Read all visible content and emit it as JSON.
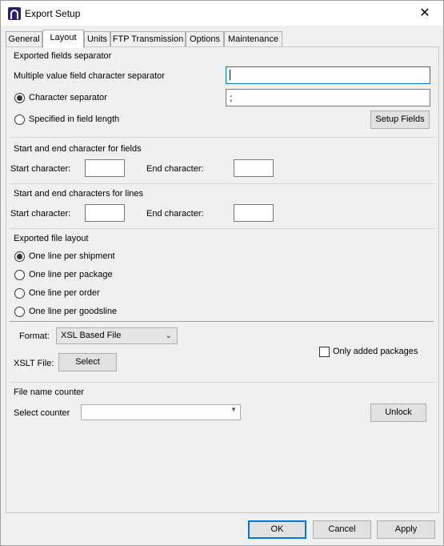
{
  "window": {
    "title": "Export Setup",
    "close_glyph": "✕"
  },
  "tabs": [
    {
      "label": "General"
    },
    {
      "label": "Layout"
    },
    {
      "label": "Units"
    },
    {
      "label": "FTP Transmission"
    },
    {
      "label": "Options"
    },
    {
      "label": "Maintenance"
    }
  ],
  "separator_group": {
    "title": "Exported fields separator",
    "multi_label": "Multiple value field character separator",
    "multi_value": "",
    "char_sep_label": "Character separator",
    "char_sep_value": ";",
    "char_sep_selected": true,
    "field_length_label": "Specified in field length",
    "setup_fields_label": "Setup Fields"
  },
  "fields_group": {
    "title": "Start and end character for fields",
    "start_label": "Start character:",
    "start_value": "",
    "end_label": "End character:",
    "end_value": ""
  },
  "lines_group": {
    "title": "Start and end characters for lines",
    "start_label": "Start character:",
    "start_value": "",
    "end_label": "End character:",
    "end_value": ""
  },
  "layout_group": {
    "title": "Exported file layout",
    "options": [
      {
        "label": "One line per shipment",
        "selected": true
      },
      {
        "label": "One line per package",
        "selected": false
      },
      {
        "label": "One line per order",
        "selected": false
      },
      {
        "label": "One line per goodsline",
        "selected": false
      }
    ],
    "format_label": "Format:",
    "format_value": "XSL Based File",
    "xslt_label": "XSLT File:",
    "select_label": "Select",
    "only_added_label": "Only added packages",
    "only_added_checked": false
  },
  "counter_group": {
    "title": "File name counter",
    "select_label": "Select counter",
    "select_value": "",
    "unlock_label": "Unlock"
  },
  "footer": {
    "ok_label": "OK",
    "cancel_label": "Cancel",
    "apply_label": "Apply"
  },
  "colors": {
    "accent": "#0078d7",
    "app_icon": "#2a1e7a"
  }
}
